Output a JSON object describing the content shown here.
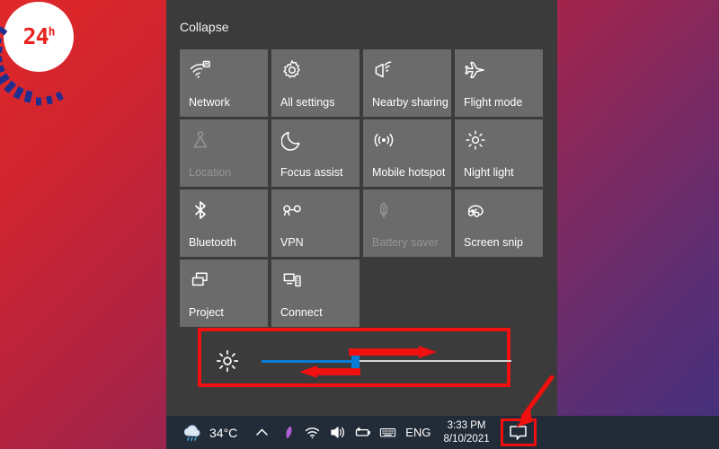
{
  "logo": {
    "text": "24",
    "superscript": "h",
    "registered": "®",
    "name": "24h-logo"
  },
  "panel": {
    "collapse_label": "Collapse",
    "tiles": [
      {
        "label": "Network",
        "icon": "wifi-icon",
        "state": "enabled"
      },
      {
        "label": "All settings",
        "icon": "gear-icon",
        "state": "enabled"
      },
      {
        "label": "Nearby sharing",
        "icon": "nearby-sharing-icon",
        "state": "enabled"
      },
      {
        "label": "Flight mode",
        "icon": "airplane-icon",
        "state": "enabled"
      },
      {
        "label": "Location",
        "icon": "location-pin-icon",
        "state": "disabled"
      },
      {
        "label": "Focus assist",
        "icon": "moon-icon",
        "state": "enabled"
      },
      {
        "label": "Mobile hotspot",
        "icon": "hotspot-icon",
        "state": "enabled"
      },
      {
        "label": "Night light",
        "icon": "sun-icon",
        "state": "enabled"
      },
      {
        "label": "Bluetooth",
        "icon": "bluetooth-icon",
        "state": "enabled"
      },
      {
        "label": "VPN",
        "icon": "vpn-icon",
        "state": "enabled"
      },
      {
        "label": "Battery saver",
        "icon": "battery-leaf-icon",
        "state": "disabled"
      },
      {
        "label": "Screen snip",
        "icon": "screen-snip-icon",
        "state": "enabled"
      },
      {
        "label": "Project",
        "icon": "project-icon",
        "state": "enabled"
      },
      {
        "label": "Connect",
        "icon": "connect-icon",
        "state": "enabled"
      }
    ]
  },
  "brightness": {
    "icon": "brightness-sun-icon",
    "value_percent": 37,
    "fill_color": "#0a7cd6",
    "track_color": "#d4d4d4",
    "highlight_color": "#f01010",
    "arrow_right": "increase-brightness-arrow",
    "arrow_left": "decrease-brightness-arrow"
  },
  "taskbar": {
    "weather": {
      "icon": "rain-cloud-icon",
      "temperature": "34°C"
    },
    "tray_icons": [
      "chevron-up-icon",
      "pen-icon",
      "wifi-icon",
      "volume-icon",
      "battery-icon",
      "keyboard-icon"
    ],
    "language": "ENG",
    "time": "3:33 PM",
    "date": "8/10/2021",
    "action_center": {
      "icon": "action-center-icon",
      "highlight_color": "#f01010"
    }
  },
  "annotations": {
    "pointer_arrow": "pointer-to-action-center",
    "color": "#f01010"
  }
}
